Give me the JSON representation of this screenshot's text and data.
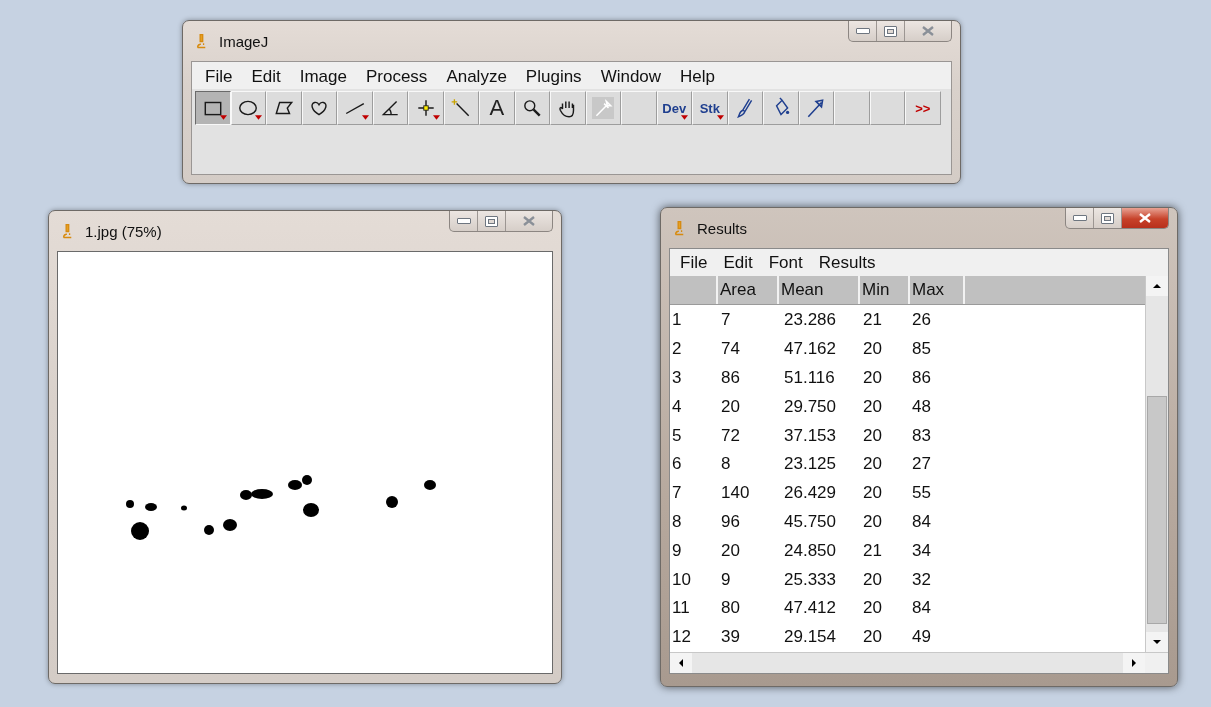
{
  "main_window": {
    "title": "ImageJ",
    "menu": [
      "File",
      "Edit",
      "Image",
      "Process",
      "Analyze",
      "Plugins",
      "Window",
      "Help"
    ],
    "tools": [
      {
        "kind": "icon",
        "selected": true,
        "has_menu": true
      },
      {
        "kind": "icon",
        "selected": false,
        "has_menu": true
      },
      {
        "kind": "icon",
        "selected": false,
        "has_menu": false
      },
      {
        "kind": "icon",
        "selected": false,
        "has_menu": false
      },
      {
        "kind": "icon",
        "selected": false,
        "has_menu": true
      },
      {
        "kind": "icon",
        "selected": false,
        "has_menu": false
      },
      {
        "kind": "icon",
        "selected": false,
        "has_menu": true
      },
      {
        "kind": "icon",
        "selected": false,
        "has_menu": false
      },
      {
        "kind": "label",
        "label": "A",
        "selected": false,
        "has_menu": false
      },
      {
        "kind": "icon",
        "selected": false,
        "has_menu": false
      },
      {
        "kind": "icon",
        "selected": false,
        "has_menu": false
      },
      {
        "kind": "icon",
        "selected": false,
        "has_menu": false,
        "disabled": true
      },
      {
        "kind": "blank",
        "selected": false,
        "has_menu": false
      },
      {
        "kind": "label",
        "label": "Dev",
        "selected": false,
        "has_menu": true
      },
      {
        "kind": "label",
        "label": "Stk",
        "selected": false,
        "has_menu": true
      },
      {
        "kind": "icon",
        "selected": false,
        "has_menu": false
      },
      {
        "kind": "icon",
        "selected": false,
        "has_menu": false
      },
      {
        "kind": "icon",
        "selected": false,
        "has_menu": false
      },
      {
        "kind": "blank",
        "selected": false,
        "has_menu": false
      },
      {
        "kind": "blank",
        "selected": false,
        "has_menu": false
      },
      {
        "kind": "more",
        "label": ">>",
        "selected": false,
        "has_menu": false
      }
    ]
  },
  "image_window": {
    "title": "1.jpg (75%)"
  },
  "results_window": {
    "title": "Results",
    "active": true,
    "menu": [
      "File",
      "Edit",
      "Font",
      "Results"
    ],
    "columns": [
      "Area",
      "Mean",
      "Min",
      "Max"
    ],
    "rows": [
      {
        "label": "1",
        "cells": [
          "7",
          "23.286",
          "21",
          "26"
        ]
      },
      {
        "label": "2",
        "cells": [
          "74",
          "47.162",
          "20",
          "85"
        ]
      },
      {
        "label": "3",
        "cells": [
          "86",
          "51.116",
          "20",
          "86"
        ]
      },
      {
        "label": "4",
        "cells": [
          "20",
          "29.750",
          "20",
          "48"
        ]
      },
      {
        "label": "5",
        "cells": [
          "72",
          "37.153",
          "20",
          "83"
        ]
      },
      {
        "label": "6",
        "cells": [
          "8",
          "23.125",
          "20",
          "27"
        ]
      },
      {
        "label": "7",
        "cells": [
          "140",
          "26.429",
          "20",
          "55"
        ]
      },
      {
        "label": "8",
        "cells": [
          "96",
          "45.750",
          "20",
          "84"
        ]
      },
      {
        "label": "9",
        "cells": [
          "20",
          "24.850",
          "21",
          "34"
        ]
      },
      {
        "label": "10",
        "cells": [
          "9",
          "25.333",
          "20",
          "32"
        ]
      },
      {
        "label": "11",
        "cells": [
          "80",
          "47.412",
          "20",
          "84"
        ]
      },
      {
        "label": "12",
        "cells": [
          "39",
          "29.154",
          "20",
          "49"
        ]
      }
    ]
  }
}
